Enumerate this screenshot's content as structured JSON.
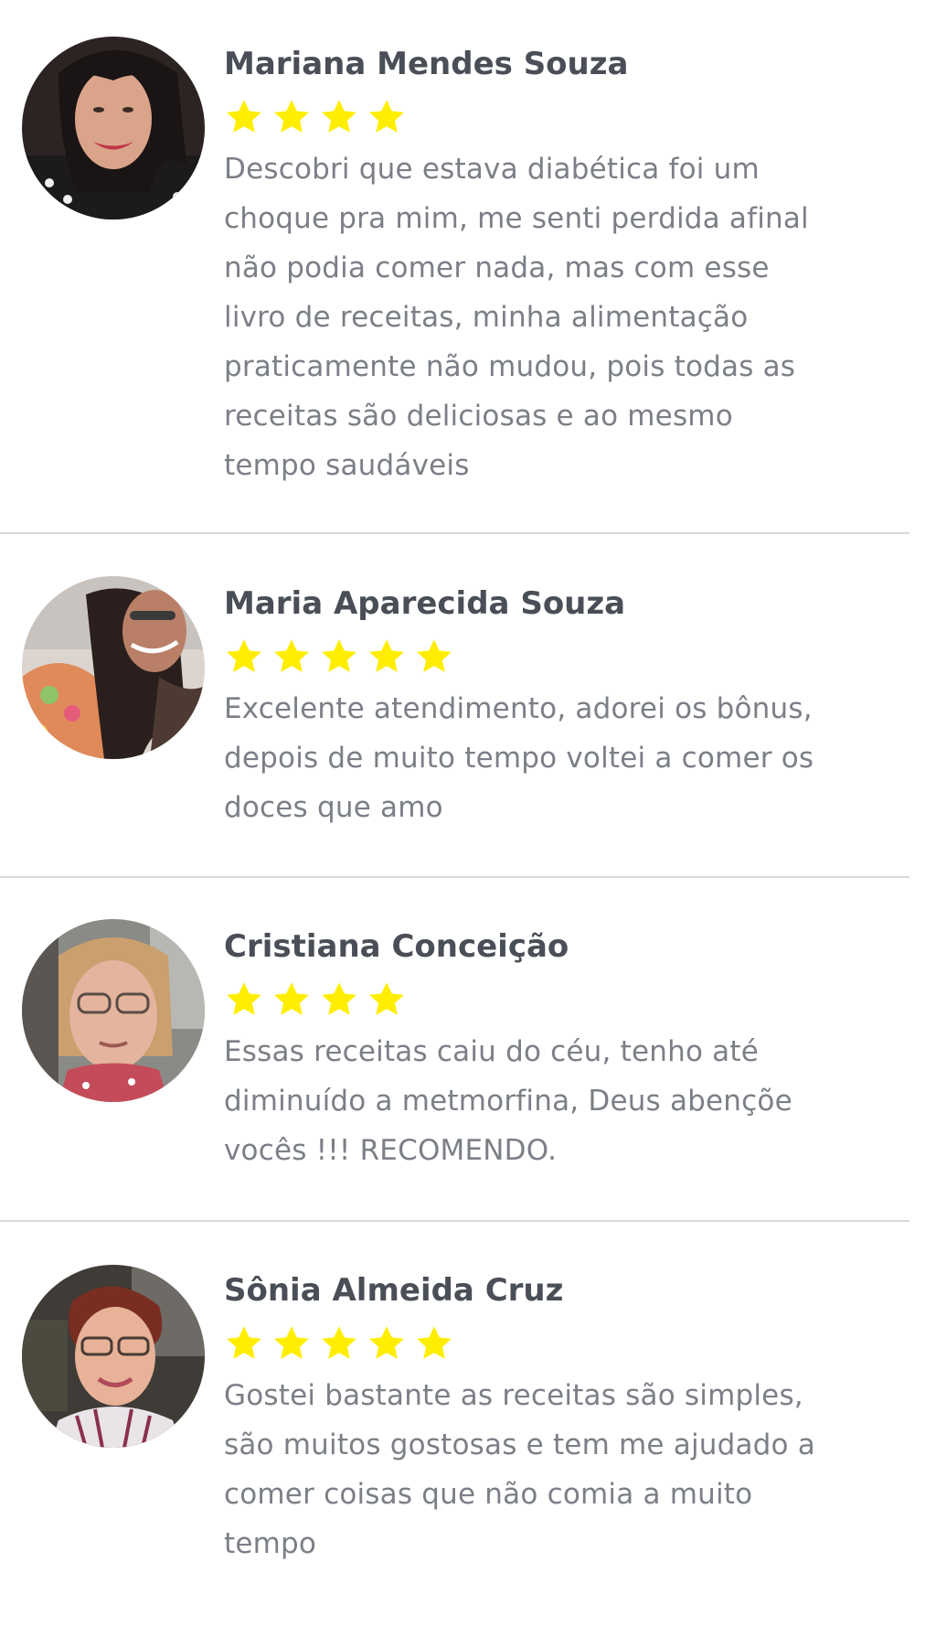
{
  "reviews": [
    {
      "name": "Mariana Mendes Souza",
      "rating": 4,
      "text": "Descobri que estava diabética foi um\nchoque pra mim, me senti perdida afinal\nnão podia comer nada, mas com esse\nlivro de receitas, minha alimentação\npraticamente não mudou, pois todas as\nreceitas são deliciosas e ao mesmo\ntempo saudáveis"
    },
    {
      "name": "Maria Aparecida Souza",
      "rating": 5,
      "text": "Excelente atendimento, adorei os bônus,\ndepois de muito tempo voltei a comer os\ndoces que amo"
    },
    {
      "name": "Cristiana Conceição",
      "rating": 4,
      "text": "Essas receitas caiu do céu, tenho até\ndiminuído a metmorfina, Deus abençõe\nvocês !!! RECOMENDO."
    },
    {
      "name": "Sônia Almeida Cruz",
      "rating": 5,
      "text": "Gostei bastante as receitas são simples,\nsão muitos gostosas e tem me ajudado a\ncomer coisas que não comia a muito\ntempo"
    }
  ],
  "colors": {
    "star": "#ffee00",
    "name": "#4a4e57",
    "text": "#7b7f86",
    "divider": "#dadada"
  }
}
